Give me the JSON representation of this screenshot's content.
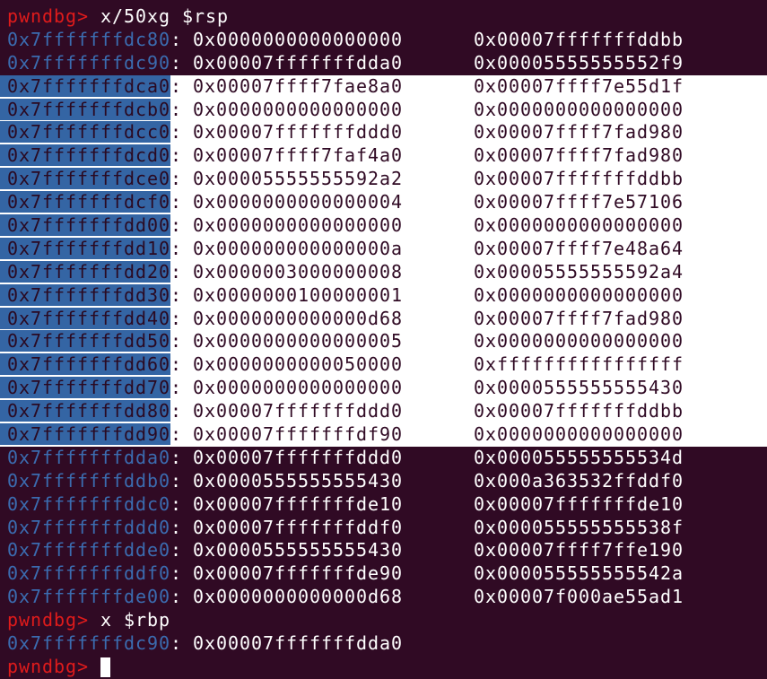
{
  "prompt": "pwndbg>",
  "command1": "x/50xg $rsp",
  "dump": [
    {
      "addr": "0x7fffffffdc80",
      "v1": "0x0000000000000000",
      "v2": "0x00007fffffffddbb",
      "selected": false
    },
    {
      "addr": "0x7fffffffdc90",
      "v1": "0x00007fffffffdda0",
      "v2": "0x00005555555552f9",
      "selected": false
    },
    {
      "addr": "0x7fffffffdca0",
      "v1": "0x00007ffff7fae8a0",
      "v2": "0x00007ffff7e55d1f",
      "selected": true
    },
    {
      "addr": "0x7fffffffdcb0",
      "v1": "0x0000000000000000",
      "v2": "0x0000000000000000",
      "selected": true
    },
    {
      "addr": "0x7fffffffdcc0",
      "v1": "0x00007fffffffddd0",
      "v2": "0x00007ffff7fad980",
      "selected": true
    },
    {
      "addr": "0x7fffffffdcd0",
      "v1": "0x00007ffff7faf4a0",
      "v2": "0x00007ffff7fad980",
      "selected": true
    },
    {
      "addr": "0x7fffffffdce0",
      "v1": "0x00005555555592a2",
      "v2": "0x00007fffffffddbb",
      "selected": true
    },
    {
      "addr": "0x7fffffffdcf0",
      "v1": "0x0000000000000004",
      "v2": "0x00007ffff7e57106",
      "selected": true
    },
    {
      "addr": "0x7fffffffdd00",
      "v1": "0x0000000000000000",
      "v2": "0x0000000000000000",
      "selected": true
    },
    {
      "addr": "0x7fffffffdd10",
      "v1": "0x000000000000000a",
      "v2": "0x00007ffff7e48a64",
      "selected": true
    },
    {
      "addr": "0x7fffffffdd20",
      "v1": "0x0000003000000008",
      "v2": "0x00005555555592a4",
      "selected": true
    },
    {
      "addr": "0x7fffffffdd30",
      "v1": "0x0000000100000001",
      "v2": "0x0000000000000000",
      "selected": true
    },
    {
      "addr": "0x7fffffffdd40",
      "v1": "0x0000000000000d68",
      "v2": "0x00007ffff7fad980",
      "selected": true
    },
    {
      "addr": "0x7fffffffdd50",
      "v1": "0x0000000000000005",
      "v2": "0x0000000000000000",
      "selected": true
    },
    {
      "addr": "0x7fffffffdd60",
      "v1": "0x0000000000050000",
      "v2": "0xffffffffffffffff",
      "selected": true
    },
    {
      "addr": "0x7fffffffdd70",
      "v1": "0x0000000000000000",
      "v2": "0x0000555555555430",
      "selected": true
    },
    {
      "addr": "0x7fffffffdd80",
      "v1": "0x00007fffffffddd0",
      "v2": "0x00007fffffffddbb",
      "selected": true
    },
    {
      "addr": "0x7fffffffdd90",
      "v1": "0x00007fffffffdf90",
      "v2": "0x0000000000000000",
      "selected": true
    },
    {
      "addr": "0x7fffffffdda0",
      "v1": "0x00007fffffffddd0",
      "v2": "0x000055555555534d",
      "selected": false
    },
    {
      "addr": "0x7fffffffddb0",
      "v1": "0x0000555555555430",
      "v2": "0x000a363532ffddf0",
      "selected": false
    },
    {
      "addr": "0x7fffffffddc0",
      "v1": "0x00007fffffffde10",
      "v2": "0x00007fffffffde10",
      "selected": false
    },
    {
      "addr": "0x7fffffffddd0",
      "v1": "0x00007fffffffddf0",
      "v2": "0x000055555555538f",
      "selected": false
    },
    {
      "addr": "0x7fffffffdde0",
      "v1": "0x0000555555555430",
      "v2": "0x00007ffff7ffe190",
      "selected": false
    },
    {
      "addr": "0x7fffffffddf0",
      "v1": "0x00007fffffffde90",
      "v2": "0x000055555555542a",
      "selected": false
    },
    {
      "addr": "0x7fffffffde00",
      "v1": "0x0000000000000d68",
      "v2": "0x00007f000ae55ad1",
      "selected": false
    }
  ],
  "command2": "x $rbp",
  "rbp_result": {
    "addr": "0x7fffffffdc90",
    "v1": "0x00007fffffffdda0"
  },
  "colors": {
    "background": "#300a24",
    "prompt": "#e01b1b",
    "address": "#3b6cb0",
    "selection": "#ffffff",
    "address_selection": "#3465a4"
  }
}
